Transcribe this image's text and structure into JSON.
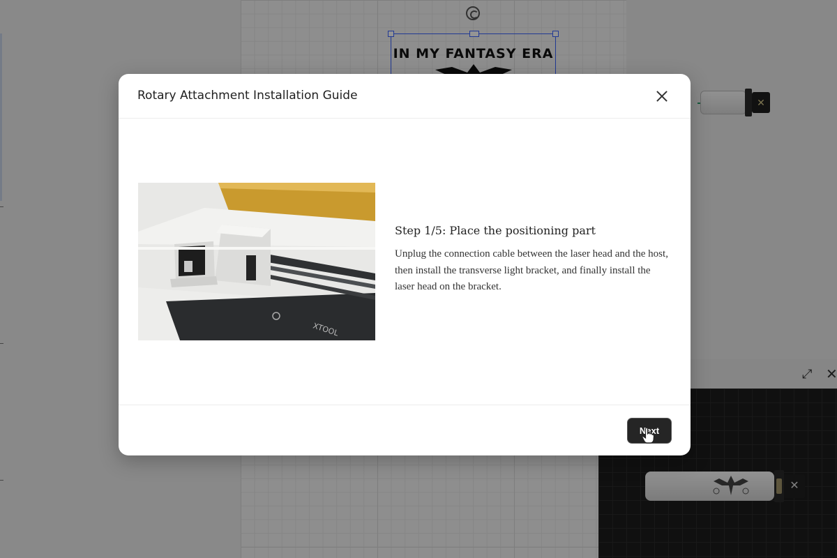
{
  "background": {
    "design_text": "IN MY FANTASY ERA",
    "rotate_icon": "rotate-icon",
    "preview_expand_icon": "expand-icon",
    "preview_close_icon": "close-icon",
    "close_glyph": "✕",
    "expand_glyph": "⤢"
  },
  "modal": {
    "title": "Rotary Attachment Installation Guide",
    "close_icon": "close-icon",
    "illustration": {
      "icon": "laser-engraver-illustration",
      "brand_text": "XTOOL"
    },
    "step_title": "Step 1/5: Place the positioning part",
    "step_description": "Unplug the connection cable between the laser head and the host, then install the transverse light bracket, and finally install the laser head on the bracket.",
    "next_label": "Next"
  },
  "colors": {
    "overlay": "rgba(0,0,0,0.42)",
    "primary_button": "#252525",
    "selection": "#3a62ff"
  }
}
